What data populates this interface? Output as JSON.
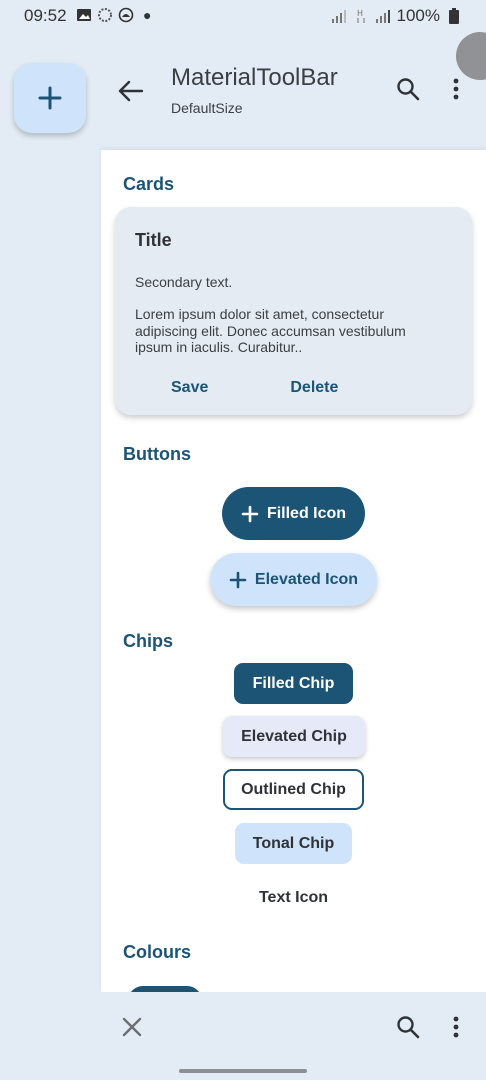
{
  "status_bar": {
    "time": "09:52",
    "battery": "100%",
    "icons": [
      "image-icon",
      "sync-icon",
      "vpn-icon",
      "dot-icon",
      "signal-icon",
      "network-h-icon",
      "signal-icon-2",
      "battery-icon"
    ]
  },
  "fab": {
    "icon": "plus-icon"
  },
  "app_bar": {
    "title": "MaterialToolBar",
    "subtitle": "DefaultSize",
    "back_icon": "arrow-back-icon",
    "actions": [
      "search-icon",
      "more-vert-icon"
    ]
  },
  "sections": {
    "cards": "Cards",
    "buttons": "Buttons",
    "chips": "Chips",
    "colours": "Colours"
  },
  "card": {
    "title": "Title",
    "secondary": "Secondary text.",
    "body": "Lorem ipsum dolor sit amet, consectetur adipiscing elit. Donec accumsan vestibulum ipsum in iaculis. Curabitur..",
    "actions": [
      "Save",
      "Delete"
    ]
  },
  "buttons": {
    "filled_icon": "Filled Icon",
    "elevated_icon": "Elevated Icon"
  },
  "chips": {
    "filled": "Filled Chip",
    "elevated": "Elevated Chip",
    "outlined": "Outlined Chip",
    "tonal": "Tonal Chip",
    "text_icon": "Text Icon"
  },
  "bottom_bar": {
    "actions": [
      "close-icon",
      "search-icon",
      "more-vert-icon"
    ]
  },
  "colors": {
    "primary": "#1c5476",
    "primary_container": "#cfe4fb",
    "surface": "#e3ecf5",
    "card_surface": "#e5ebf2"
  }
}
